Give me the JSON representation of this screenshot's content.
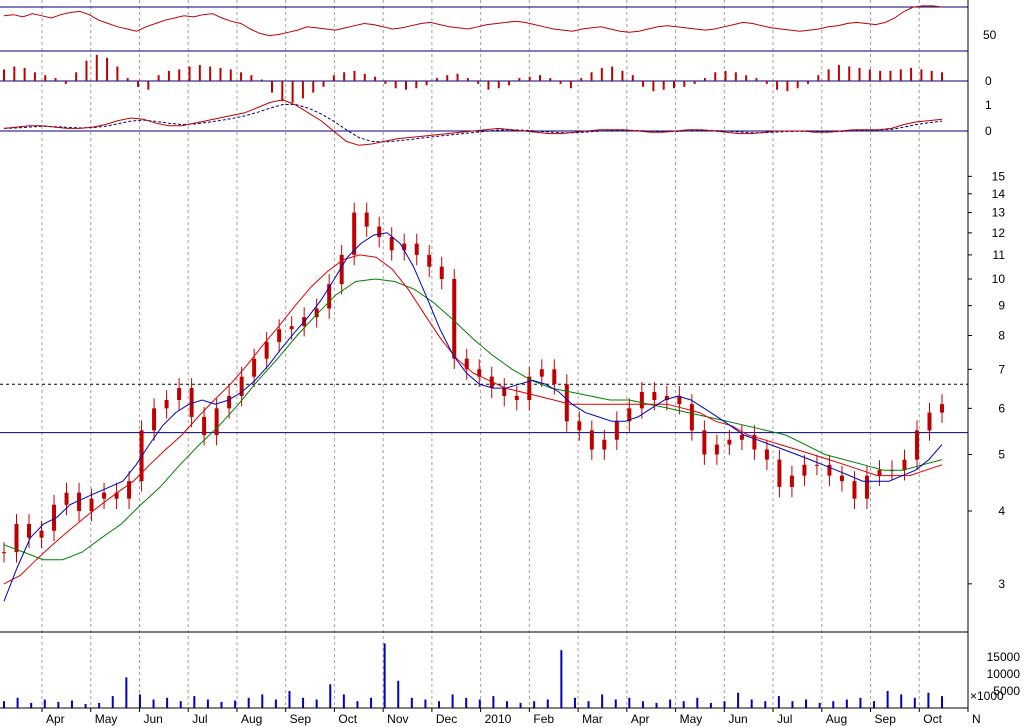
{
  "chart_data": [
    {
      "type": "line",
      "panel": "rsi",
      "y_ticks": [
        50
      ],
      "y_tick_labels": [
        "50"
      ],
      "reference_levels": [
        70,
        30
      ],
      "ylim": [
        0,
        100
      ],
      "colors": {
        "line": "#c00000",
        "ref": "#000080"
      },
      "series": [
        {
          "values": [
            62,
            63,
            61,
            64,
            62,
            60,
            63,
            65,
            66,
            63,
            58,
            55,
            52,
            50,
            48,
            52,
            55,
            58,
            60,
            62,
            61,
            63,
            64,
            60,
            57,
            55,
            50,
            46,
            44,
            45,
            47,
            49,
            52,
            51,
            50,
            49,
            51,
            53,
            55,
            54,
            52,
            50,
            51,
            53,
            55,
            56,
            54,
            52,
            51,
            50,
            52,
            54,
            55,
            56,
            57,
            56,
            54,
            52,
            50,
            49,
            48,
            50,
            51,
            52,
            50,
            48,
            47,
            48,
            50,
            52,
            53,
            52,
            51,
            50,
            49,
            50,
            52,
            54,
            56,
            55,
            53,
            51,
            50,
            49,
            48,
            49,
            50,
            52,
            53,
            55,
            56,
            55,
            54,
            56,
            60,
            66,
            70,
            71,
            71,
            70
          ]
        }
      ]
    },
    {
      "type": "bar",
      "panel": "macd-histogram",
      "y_ticks": [
        0
      ],
      "y_tick_labels": [
        "0"
      ],
      "ylim": [
        -1,
        1
      ],
      "colors": {
        "bars": "#c00000",
        "zero": "#000080"
      },
      "series": [
        {
          "values": [
            0.4,
            0.5,
            0.45,
            0.3,
            0.2,
            0.1,
            -0.1,
            0.3,
            0.7,
            0.9,
            0.8,
            0.5,
            0.1,
            -0.2,
            -0.3,
            0.2,
            0.35,
            0.4,
            0.5,
            0.55,
            0.5,
            0.45,
            0.4,
            0.3,
            0.2,
            0.05,
            -0.4,
            -0.7,
            -0.75,
            -0.6,
            -0.4,
            -0.2,
            0.2,
            0.3,
            0.35,
            0.25,
            0.15,
            -0.1,
            -0.25,
            -0.3,
            -0.25,
            -0.15,
            0.1,
            0.2,
            0.25,
            0.1,
            -0.1,
            -0.3,
            -0.25,
            -0.15,
            0.1,
            0.15,
            0.2,
            0.1,
            -0.1,
            -0.25,
            0.1,
            0.3,
            0.45,
            0.5,
            0.35,
            0.2,
            -0.2,
            -0.35,
            -0.3,
            -0.25,
            -0.2,
            -0.1,
            0.1,
            0.3,
            0.35,
            0.3,
            0.2,
            0.1,
            -0.1,
            -0.3,
            -0.35,
            -0.25,
            -0.1,
            0.2,
            0.4,
            0.55,
            0.5,
            0.45,
            0.4,
            0.35,
            0.35,
            0.4,
            0.45,
            0.4,
            0.35,
            0.3
          ]
        }
      ]
    },
    {
      "type": "line",
      "panel": "macd",
      "y_ticks": [
        1,
        0
      ],
      "y_tick_labels": [
        "1",
        "0"
      ],
      "ylim": [
        -1.5,
        1.5
      ],
      "colors": {
        "macd": "#c00000",
        "signal": "#000080",
        "zero": "#000080"
      },
      "series": [
        {
          "values": [
            0.1,
            0.15,
            0.2,
            0.2,
            0.15,
            0.1,
            0.1,
            0.15,
            0.25,
            0.4,
            0.5,
            0.45,
            0.3,
            0.2,
            0.2,
            0.3,
            0.4,
            0.5,
            0.6,
            0.7,
            0.9,
            1.1,
            1.2,
            1.0,
            0.7,
            0.4,
            0.0,
            -0.4,
            -0.55,
            -0.5,
            -0.4,
            -0.3,
            -0.25,
            -0.2,
            -0.15,
            -0.1,
            -0.05,
            0.0,
            0.05,
            0.1,
            0.05,
            0.0,
            -0.05,
            -0.1,
            -0.1,
            -0.05,
            0.0,
            0.05,
            0.05,
            0.05,
            0.0,
            -0.05,
            -0.05,
            0.0,
            0.05,
            0.05,
            0.0,
            -0.05,
            -0.1,
            -0.1,
            -0.05,
            0.0,
            0.0,
            0.0,
            -0.05,
            -0.05,
            0.0,
            0.05,
            0.05,
            0.05,
            0.1,
            0.25,
            0.35,
            0.4,
            0.45
          ]
        },
        {
          "values": [
            0.1,
            0.12,
            0.15,
            0.18,
            0.17,
            0.14,
            0.12,
            0.13,
            0.18,
            0.28,
            0.38,
            0.42,
            0.37,
            0.3,
            0.25,
            0.27,
            0.33,
            0.4,
            0.48,
            0.58,
            0.72,
            0.88,
            1.02,
            1.02,
            0.88,
            0.66,
            0.38,
            0.05,
            -0.25,
            -0.4,
            -0.42,
            -0.38,
            -0.33,
            -0.27,
            -0.21,
            -0.16,
            -0.11,
            -0.06,
            -0.01,
            0.04,
            0.05,
            0.03,
            0.0,
            -0.04,
            -0.07,
            -0.07,
            -0.04,
            0.0,
            0.02,
            0.03,
            0.02,
            -0.01,
            -0.03,
            -0.02,
            0.01,
            0.03,
            0.02,
            0.0,
            -0.04,
            -0.07,
            -0.07,
            -0.04,
            -0.02,
            -0.01,
            -0.03,
            -0.04,
            -0.02,
            0.01,
            0.03,
            0.04,
            0.06,
            0.15,
            0.25,
            0.32,
            0.38
          ]
        }
      ]
    },
    {
      "type": "candlestick",
      "panel": "price",
      "scale": "log",
      "ylim": [
        2.5,
        16
      ],
      "y_ticks": [
        15,
        14,
        13,
        12,
        11,
        10,
        9,
        8,
        7,
        6,
        5,
        4,
        3
      ],
      "y_tick_labels": [
        "15",
        "14",
        "13",
        "12",
        "11",
        "10",
        "9",
        "8",
        "7",
        "6",
        "5",
        "4",
        "3"
      ],
      "x_tick_labels": [
        "Apr",
        "May",
        "Jun",
        "Jul",
        "Aug",
        "Sep",
        "Oct",
        "Nov",
        "Dec",
        "2010",
        "Feb",
        "Mar",
        "Apr",
        "May",
        "Jun",
        "Jul",
        "Aug",
        "Sep",
        "Oct",
        "N"
      ],
      "reference_levels": [
        {
          "value": 6.6,
          "style": "dashed",
          "color": "#000000"
        },
        {
          "value": 5.45,
          "style": "solid",
          "color": "#000080"
        }
      ],
      "colors": {
        "candles": "#c00000",
        "ma_short": "#0000c0",
        "ma_mid": "#e00000",
        "ma_long": "#008000"
      },
      "series": [
        {
          "role": "close",
          "values": [
            3.4,
            3.8,
            3.6,
            3.7,
            4.1,
            4.3,
            4.0,
            4.2,
            4.3,
            4.2,
            4.5,
            5.5,
            6.0,
            6.2,
            6.5,
            5.8,
            5.4,
            6.0,
            6.3,
            6.8,
            7.3,
            7.8,
            8.2,
            8.3,
            8.6,
            8.9,
            9.8,
            11.0,
            13.0,
            12.3,
            11.8,
            11.2,
            11.5,
            11.0,
            10.5,
            10.0,
            7.3,
            7.0,
            6.8,
            6.5,
            6.3,
            6.2,
            6.8,
            7.0,
            6.6,
            5.7,
            5.5,
            5.1,
            5.3,
            5.7,
            6.0,
            6.4,
            6.2,
            6.3,
            6.1,
            5.5,
            5.0,
            5.2,
            5.3,
            5.4,
            5.1,
            4.9,
            4.4,
            4.6,
            4.8,
            4.8,
            4.6,
            4.5,
            4.2,
            4.6,
            4.7,
            4.7,
            4.9,
            5.5,
            5.9,
            6.1
          ]
        },
        {
          "role": "ma_short",
          "values": [
            2.8,
            3.2,
            3.6,
            3.8,
            3.9,
            4.1,
            4.2,
            4.3,
            4.4,
            4.5,
            4.8,
            5.2,
            5.6,
            5.9,
            6.1,
            6.2,
            6.1,
            6.2,
            6.4,
            6.7,
            7.1,
            7.6,
            8.1,
            8.6,
            9.2,
            10.0,
            10.9,
            11.5,
            11.9,
            12.0,
            11.5,
            10.5,
            9.3,
            8.2,
            7.4,
            6.9,
            6.6,
            6.5,
            6.5,
            6.6,
            6.7,
            6.6,
            6.4,
            6.1,
            5.9,
            5.8,
            5.7,
            5.7,
            5.8,
            6.0,
            6.2,
            6.3,
            6.2,
            6.0,
            5.8,
            5.6,
            5.4,
            5.3,
            5.2,
            5.1,
            5.0,
            4.9,
            4.8,
            4.7,
            4.6,
            4.5,
            4.5,
            4.5,
            4.6,
            4.7,
            4.9,
            5.2
          ]
        },
        {
          "role": "ma_mid",
          "values": [
            3.0,
            3.1,
            3.3,
            3.5,
            3.7,
            3.9,
            4.1,
            4.3,
            4.5,
            4.8,
            5.1,
            5.4,
            5.8,
            6.2,
            6.6,
            7.1,
            7.7,
            8.3,
            9.0,
            9.7,
            10.3,
            10.8,
            11.0,
            10.9,
            10.4,
            9.6,
            8.7,
            7.9,
            7.3,
            6.9,
            6.7,
            6.5,
            6.4,
            6.3,
            6.2,
            6.1,
            6.1,
            6.1,
            6.1,
            6.1,
            6.1,
            6.1,
            6.0,
            5.9,
            5.7,
            5.6,
            5.4,
            5.3,
            5.2,
            5.1,
            5.0,
            4.9,
            4.8,
            4.7,
            4.6,
            4.6,
            4.6,
            4.7,
            4.8
          ]
        },
        {
          "role": "ma_long",
          "values": [
            3.5,
            3.4,
            3.3,
            3.3,
            3.4,
            3.6,
            3.8,
            4.1,
            4.4,
            4.8,
            5.2,
            5.6,
            6.1,
            6.7,
            7.3,
            8.0,
            8.7,
            9.4,
            9.9,
            10.0,
            9.9,
            9.6,
            9.1,
            8.5,
            7.9,
            7.4,
            7.0,
            6.7,
            6.5,
            6.4,
            6.3,
            6.2,
            6.2,
            6.1,
            6.0,
            5.9,
            5.8,
            5.7,
            5.6,
            5.5,
            5.4,
            5.2,
            5.0,
            4.9,
            4.8,
            4.7,
            4.7,
            4.8,
            4.9
          ]
        }
      ]
    },
    {
      "type": "bar",
      "panel": "volume",
      "y_ticks": [
        15000,
        10000,
        5000
      ],
      "y_tick_labels": [
        "15000",
        "10000",
        "5000"
      ],
      "units_label": "×1000",
      "ylim": [
        0,
        20000
      ],
      "colors": {
        "bars": "#0000c0"
      },
      "series": [
        {
          "values": [
            2000,
            3000,
            1500,
            2500,
            1800,
            2200,
            1200,
            1500,
            3500,
            9000,
            4000,
            2500,
            3000,
            2000,
            3500,
            2500,
            1800,
            2200,
            3000,
            4000,
            2500,
            5000,
            3000,
            2500,
            7000,
            4000,
            2000,
            3000,
            19000,
            8000,
            3000,
            2500,
            2000,
            4000,
            3000,
            2500,
            3500,
            2000,
            1500,
            2000,
            2500,
            17000,
            3000,
            2000,
            4000,
            2500,
            3000,
            2000,
            1500,
            2500,
            2000,
            3000,
            1500,
            2000,
            4500,
            2500,
            2000,
            3500,
            2000,
            2500,
            1500,
            2000,
            2500,
            3000,
            2000,
            5000,
            4000,
            3000,
            4500,
            3500
          ]
        }
      ]
    }
  ]
}
